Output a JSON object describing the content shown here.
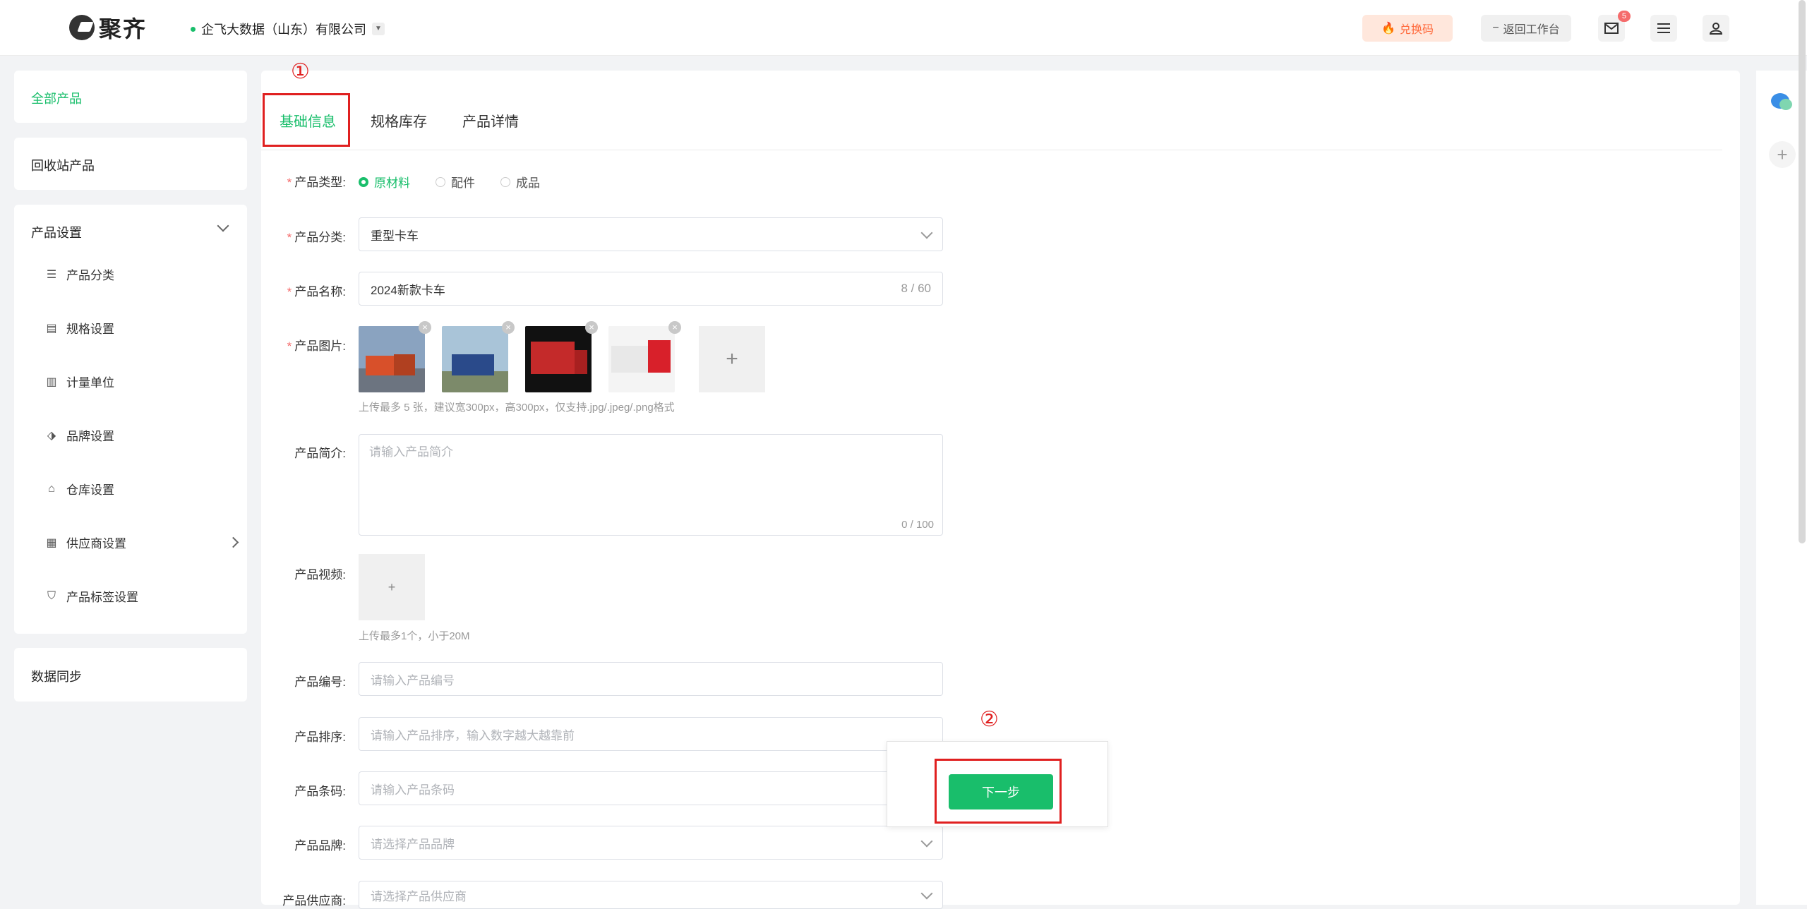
{
  "header": {
    "logo_text": "聚齐",
    "company": "企飞大数据（山东）有限公司",
    "redeem_label": "兑换码",
    "back_workspace_label": "返回工作台",
    "mail_badge": "5",
    "icons": [
      "mail-icon",
      "menu-icon",
      "user-icon"
    ]
  },
  "sidebar": {
    "all_products": "全部产品",
    "recycle": "回收站产品",
    "settings_title": "产品设置",
    "settings_items": [
      {
        "label": "产品分类",
        "icon": "list-icon"
      },
      {
        "label": "规格设置",
        "icon": "spec-icon"
      },
      {
        "label": "计量单位",
        "icon": "unit-icon"
      },
      {
        "label": "品牌设置",
        "icon": "tag-icon"
      },
      {
        "label": "仓库设置",
        "icon": "warehouse-icon"
      },
      {
        "label": "供应商设置",
        "icon": "supplier-icon"
      },
      {
        "label": "产品标签设置",
        "icon": "bookmark-icon"
      }
    ],
    "data_sync": "数据同步",
    "active_color": "#19be6b"
  },
  "tabs": [
    "基础信息",
    "规格库存",
    "产品详情"
  ],
  "annotations": {
    "step1": "①",
    "step2": "②",
    "color": "#e02020"
  },
  "form": {
    "type_label": "产品类型:",
    "type_options": [
      "原材料",
      "配件",
      "成品"
    ],
    "type_selected": "原材料",
    "category_label": "产品分类:",
    "category_value": "重型卡车",
    "name_label": "产品名称:",
    "name_value": "2024新款卡车",
    "name_count": "8 / 60",
    "image_label": "产品图片:",
    "image_hint": "上传最多 5 张，建议宽300px，高300px，仅支持.jpg/.jpeg/.png格式",
    "intro_label": "产品简介:",
    "intro_placeholder": "请输入产品简介",
    "intro_count": "0 / 100",
    "video_label": "产品视频:",
    "video_hint": "上传最多1个，小于20M",
    "code_label": "产品编号:",
    "code_placeholder": "请输入产品编号",
    "sort_label": "产品排序:",
    "sort_placeholder": "请输入产品排序，输入数字越大越靠前",
    "barcode_label": "产品条码:",
    "barcode_placeholder": "请输入产品条码",
    "brand_label": "产品品牌:",
    "brand_placeholder": "请选择产品品牌",
    "supplier_label": "产品供应商:",
    "supplier_placeholder": "请选择产品供应商"
  },
  "next_button": "下一步",
  "accent_color": "#19be6b"
}
